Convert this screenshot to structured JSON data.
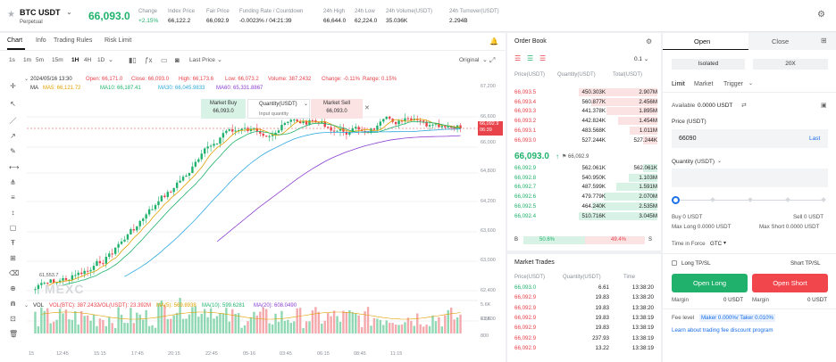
{
  "header": {
    "symbol": "BTC USDT",
    "type": "Perpetual",
    "price": "66,093.0",
    "stats": [
      {
        "label": "Change",
        "value": "+2.15%",
        "color": "green"
      },
      {
        "label": "Index Price",
        "value": "66,122.2",
        "color": "default"
      },
      {
        "label": "Fair Price",
        "value": "66,092.9",
        "color": "default"
      },
      {
        "label": "Funding Rate / Countdown",
        "value": "-0.0023% / 04:21:39",
        "color": "default"
      },
      {
        "label": "24h High",
        "value": "66,644.0",
        "color": "default"
      },
      {
        "label": "24h Low",
        "value": "62,224.0",
        "color": "default"
      },
      {
        "label": "24h Volume(USDT)",
        "value": "35.036K",
        "color": "default"
      },
      {
        "label": "24h Turnover(USDT)",
        "value": "2.294B",
        "color": "default"
      }
    ]
  },
  "chart_tabs": [
    "Chart",
    "Info",
    "Trading Rules",
    "Risk Limit"
  ],
  "intervals": [
    "1s",
    "1m",
    "5m",
    "15m",
    "1H",
    "4H",
    "1D"
  ],
  "last_price_label": "Last Price",
  "original_label": "Original",
  "ohlc": {
    "date": "2024/05/16 13:30",
    "open": "Open: 66,171.0",
    "close": "Close: 66,093.0",
    "high": "High: 66,173.6",
    "low": "Low: 66,073.2",
    "volume": "Volume: 387.2432",
    "change": "Change: -0.11%",
    "range": "Range: 0.15%"
  },
  "ma": {
    "label": "MA",
    "ma5": "MA5: 66,121.72",
    "ma10": "MA10: 66,187.41",
    "ma30": "MA30: 66,045.9833",
    "ma60": "MA60: 65,331.8867"
  },
  "quick_order": {
    "market_buy": "Market Buy",
    "buy_price": "66,093.0",
    "qty_label": "Quantity(USDT)",
    "qty_placeholder": "Input quantity",
    "market_sell": "Market Sell",
    "sell_price": "66,093.0"
  },
  "price_axis": [
    "67,200",
    "66,600",
    "66,000",
    "64,800",
    "64,200",
    "63,600",
    "63,000",
    "62,400",
    "61,800"
  ],
  "price_marker": "66,092.9",
  "price_marker_countdown": "06:39",
  "low_marker": "61,553.7",
  "watermark": "MEXC",
  "volume": {
    "label": "VOL",
    "vol_btc": "VOL(BTC): 387.2432",
    "vol_usdt": "VOL(USDT): 23.392M",
    "ma5": "MA(5): 569.8938",
    "ma10": "MA(10): 599.6281",
    "ma20": "MA(20): 608.0490",
    "axis": [
      "5.6K",
      "2.8K",
      "800"
    ]
  },
  "time_axis": [
    "15",
    "12:45",
    "15:15",
    "17:45",
    "20:15",
    "22:45",
    "05-16",
    "03:45",
    "06:15",
    "08:45",
    "11:15"
  ],
  "orderbook": {
    "title": "Order Book",
    "precision": "0.1",
    "headers": [
      "Price(USDT)",
      "Quantity(USDT)",
      "Total(USDT)"
    ],
    "asks": [
      {
        "price": "66,093.5",
        "qty": "450.303K",
        "total": "2.907M",
        "depth": 1.0
      },
      {
        "price": "66,093.4",
        "qty": "560.877K",
        "total": "2.456M",
        "depth": 0.84
      },
      {
        "price": "66,093.3",
        "qty": "441.378K",
        "total": "1.895M",
        "depth": 0.65
      },
      {
        "price": "66,093.2",
        "qty": "442.824K",
        "total": "1.454M",
        "depth": 0.5
      },
      {
        "price": "66,093.1",
        "qty": "483.568K",
        "total": "1.011M",
        "depth": 0.35
      },
      {
        "price": "66,093.0",
        "qty": "527.244K",
        "total": "527.244K",
        "depth": 0.18
      }
    ],
    "mid_price": "66,093.0",
    "mid_arrow": "↑",
    "mid_fair": "66,092.9",
    "bids": [
      {
        "price": "66,092.9",
        "qty": "562.061K",
        "total": "562.061K",
        "depth": 0.18
      },
      {
        "price": "66,092.8",
        "qty": "540.950K",
        "total": "1.103M",
        "depth": 0.36
      },
      {
        "price": "66,092.7",
        "qty": "487.599K",
        "total": "1.591M",
        "depth": 0.52
      },
      {
        "price": "66,092.6",
        "qty": "479.779K",
        "total": "2.070M",
        "depth": 0.68
      },
      {
        "price": "66,092.5",
        "qty": "464.240K",
        "total": "2.535M",
        "depth": 0.83
      },
      {
        "price": "66,092.4",
        "qty": "510.716K",
        "total": "3.045M",
        "depth": 1.0
      }
    ],
    "buy_ratio_label": "B",
    "buy_ratio": "50.6%",
    "sell_ratio": "49.4%",
    "sell_ratio_label": "S"
  },
  "trades": {
    "title": "Market Trades",
    "headers": [
      "Price(USDT)",
      "Quantity(USDT)",
      "Time"
    ],
    "rows": [
      {
        "price": "66,093.0",
        "qty": "6.61",
        "time": "13:38:20",
        "side": "buy"
      },
      {
        "price": "66,092.9",
        "qty": "19.83",
        "time": "13:38:20",
        "side": "sell"
      },
      {
        "price": "66,092.9",
        "qty": "19.83",
        "time": "13:38:20",
        "side": "sell"
      },
      {
        "price": "66,092.9",
        "qty": "19.83",
        "time": "13:38:19",
        "side": "sell"
      },
      {
        "price": "66,092.9",
        "qty": "19.83",
        "time": "13:38:19",
        "side": "sell"
      },
      {
        "price": "66,092.9",
        "qty": "237.93",
        "time": "13:38:19",
        "side": "sell"
      },
      {
        "price": "66,092.9",
        "qty": "13.22",
        "time": "13:38:19",
        "side": "sell"
      }
    ]
  },
  "trade_form": {
    "tab_open": "Open",
    "tab_close": "Close",
    "margin_mode": "Isolated",
    "leverage": "20X",
    "order_types": [
      "Limit",
      "Market",
      "Trigger"
    ],
    "available_label": "Available",
    "available_value": "0.0000 USDT",
    "price_label": "Price (USDT)",
    "price_value": "66090",
    "price_last": "Last",
    "qty_label": "Quantity (USDT)",
    "buy_label": "Buy 0 USDT",
    "sell_label": "Sell 0 USDT",
    "max_long": "Max Long 0.0000 USDT",
    "max_short": "Max Short 0.0000 USDT",
    "tif_label": "Time in Force",
    "tif_value": "GTC",
    "long_tpsl": "Long TP/SL",
    "short_tpsl": "Short TP/SL",
    "open_long": "Open Long",
    "open_short": "Open Short",
    "margin_label": "Margin",
    "margin_long": "0 USDT",
    "margin_short": "0 USDT",
    "fee_label": "Fee level",
    "fee_value": "Maker 0.000%/ Taker 0.010%",
    "fee_link": "Learn about trading fee discount program"
  }
}
